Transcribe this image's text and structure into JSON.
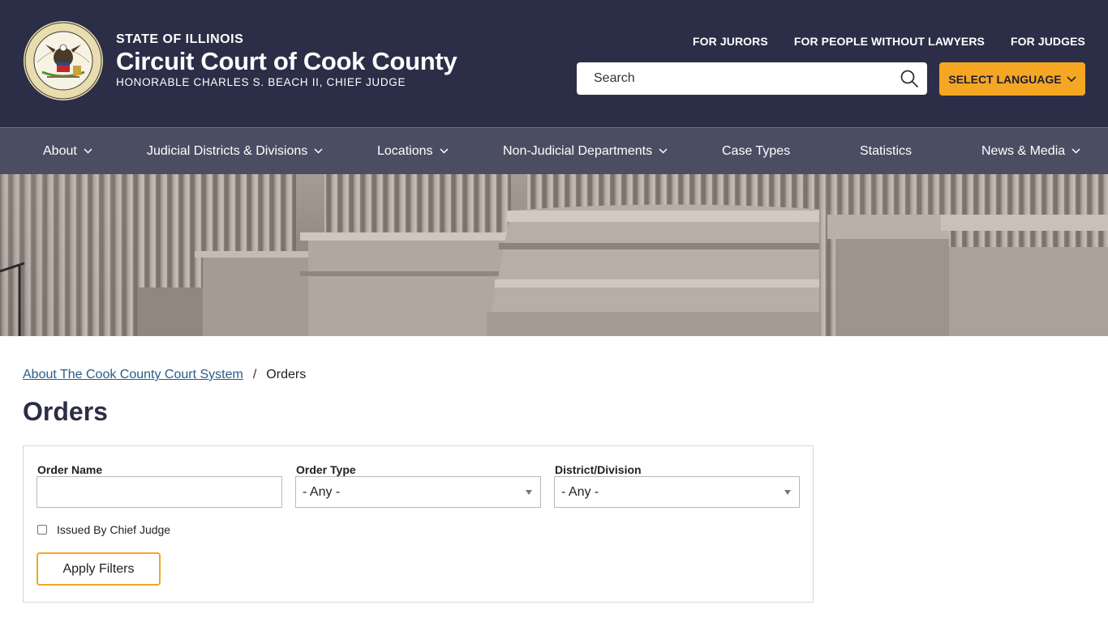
{
  "header": {
    "state": "STATE OF ILLINOIS",
    "court": "Circuit Court of Cook County",
    "judge": "HONORABLE CHARLES S. BEACH II, CHIEF JUDGE",
    "seal_icon": "illinois-state-seal"
  },
  "utility_links": [
    "FOR JURORS",
    "FOR PEOPLE WITHOUT LAWYERS",
    "FOR JUDGES"
  ],
  "search": {
    "placeholder": "Search",
    "icon": "search-icon"
  },
  "language": {
    "label": "SELECT LANGUAGE",
    "color": "#f5a623"
  },
  "nav": {
    "items": [
      {
        "label": "About",
        "dropdown": true
      },
      {
        "label": "Judicial Districts & Divisions",
        "dropdown": true
      },
      {
        "label": "Locations",
        "dropdown": true
      },
      {
        "label": "Non-Judicial Departments",
        "dropdown": true
      },
      {
        "label": "Case Types",
        "dropdown": false
      },
      {
        "label": "Statistics",
        "dropdown": false
      },
      {
        "label": "News & Media",
        "dropdown": true
      }
    ]
  },
  "breadcrumb": {
    "parent": "About The Cook County Court System",
    "separator": "/",
    "current": "Orders"
  },
  "page_title": "Orders",
  "filters": {
    "order_name_label": "Order Name",
    "order_name_value": "",
    "order_type_label": "Order Type",
    "order_type_value": "- Any -",
    "district_label": "District/Division",
    "district_value": "- Any -",
    "chief_judge_label": "Issued By Chief Judge",
    "chief_judge_checked": false,
    "apply_label": "Apply Filters"
  },
  "colors": {
    "header_bg": "#2b2e46",
    "nav_bg": "#4b4d63",
    "accent": "#f5a623",
    "link": "#2a5c8a"
  }
}
